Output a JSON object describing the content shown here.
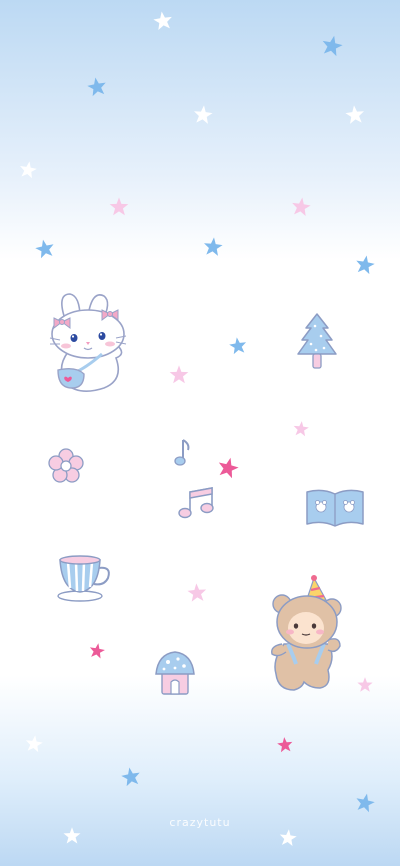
{
  "wallpaper": {
    "watermark": "crazytutu",
    "colors": {
      "sky_blue": "#bcd9f3",
      "star_blue": "#7fb9ec",
      "star_white": "#ffffff",
      "star_pink": "#f7c8e6",
      "star_hot_pink": "#ec5a98",
      "outline": "#9aa3c8"
    },
    "stickers": [
      "bunny-with-bows",
      "christmas-tree",
      "flower",
      "music-note-small",
      "music-note-double",
      "book",
      "teacup",
      "bear-party-hat",
      "mushroom-house"
    ]
  }
}
